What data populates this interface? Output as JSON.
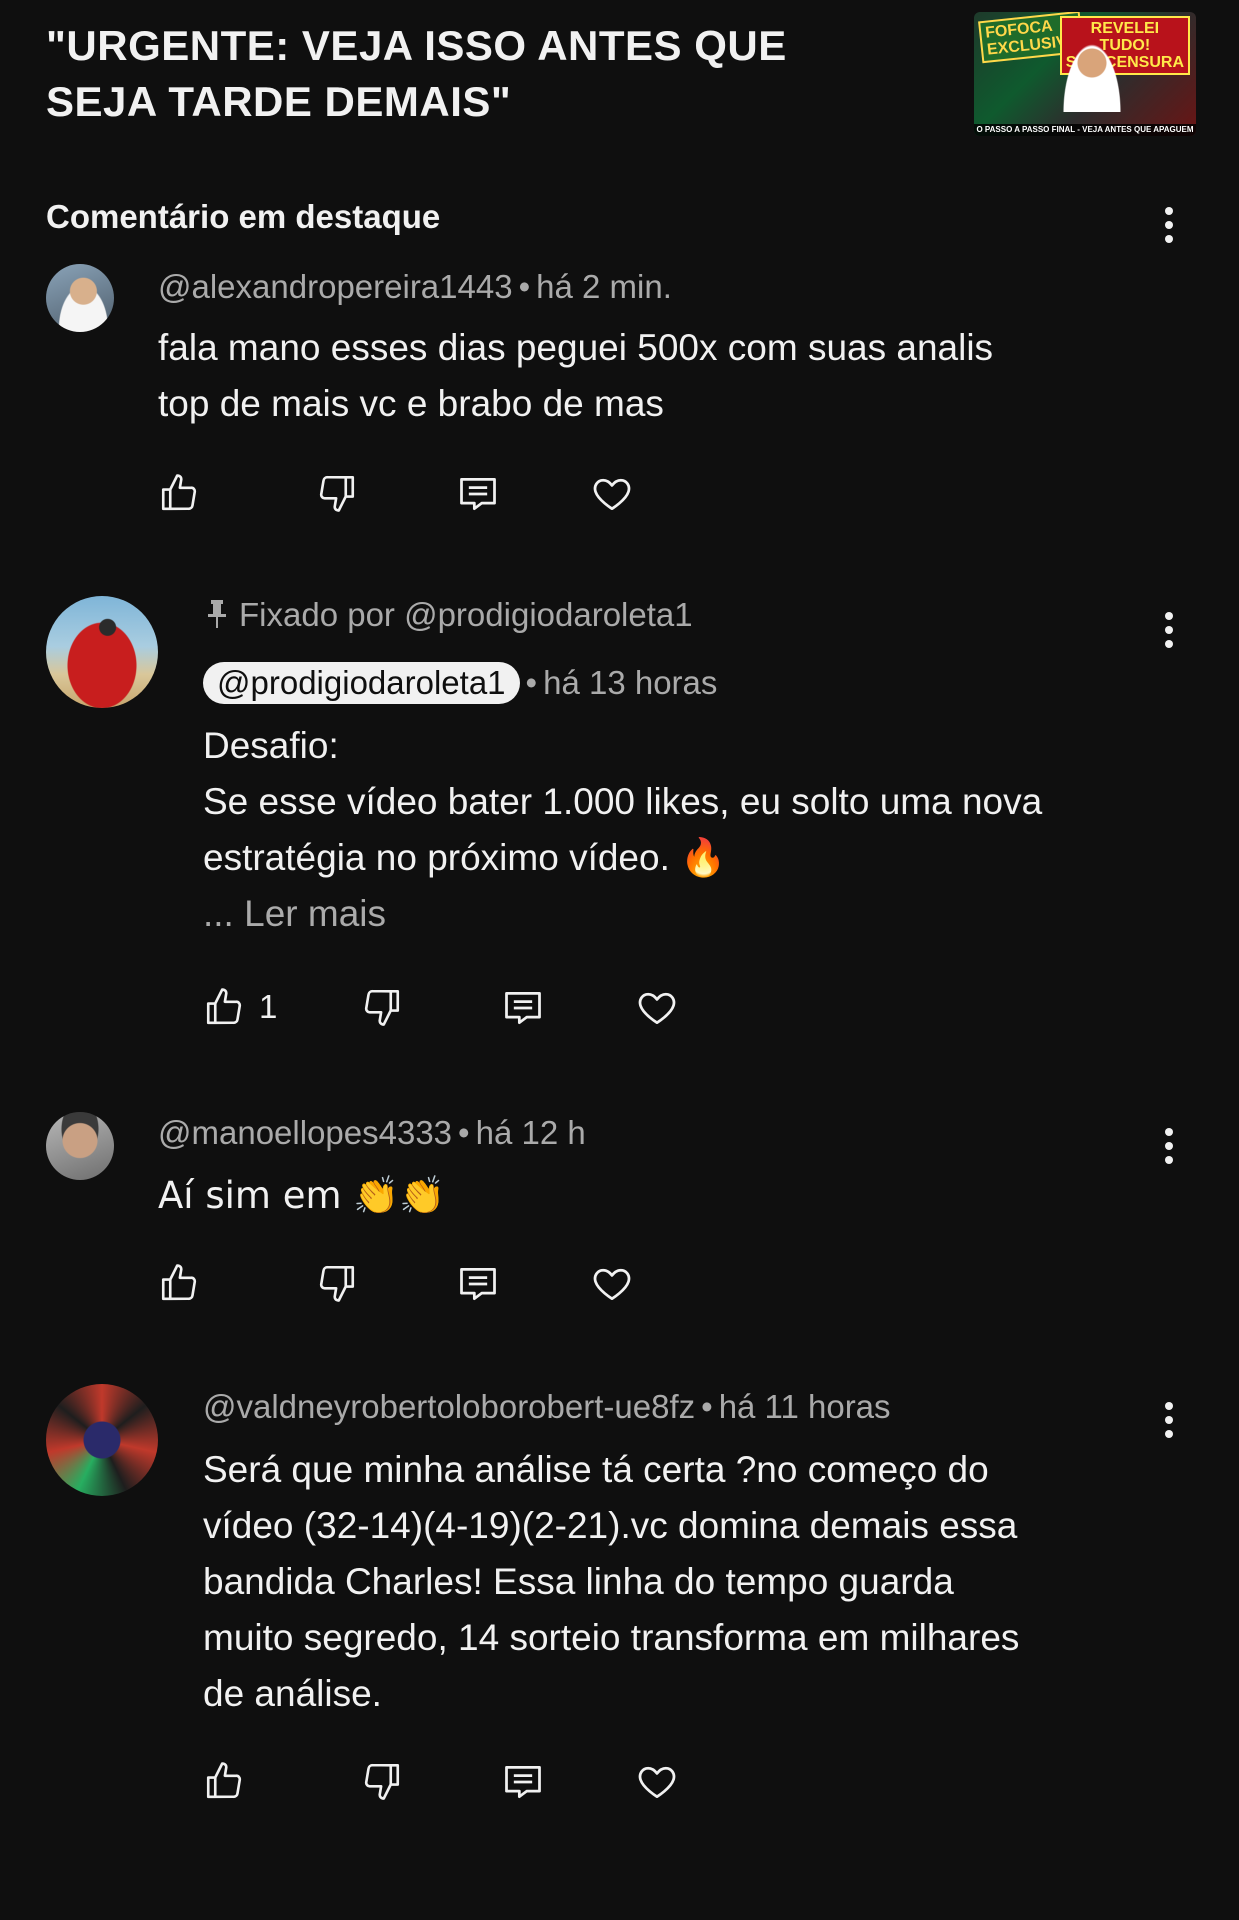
{
  "video": {
    "title": "\"URGENTE: VEJA ISSO ANTES QUE\nSEJA TARDE DEMAIS\"",
    "thumbnail": {
      "left_text": "FOFOCA\nEXCLUSIVA",
      "right_text": "REVELEI\nTUDO!\nSEM CENSURA",
      "bottom_text": "O PASSO A PASSO FINAL - VEJA ANTES QUE APAGUEM"
    }
  },
  "section": {
    "title": "Comentário em destaque"
  },
  "comments": [
    {
      "author": "@alexandropereira1443",
      "time": "há 2 min.",
      "text": "fala mano esses dias peguei 500x com suas analis\ntop de mais vc e brabo de mas",
      "likes": ""
    },
    {
      "pinned_label": "Fixado por @prodigiodaroleta1",
      "author": "@prodigiodaroleta1",
      "time": "há 13 horas",
      "text": "Desafio:\nSe esse vídeo bater 1.000 likes, eu solto uma nova\nestratégia no próximo vídeo. 🔥",
      "read_more": "... Ler mais",
      "likes": "1"
    },
    {
      "author": "@manoellopes4333",
      "time": "há 12 h",
      "text": "Aí sim em 👏👏",
      "likes": ""
    },
    {
      "author": "@valdneyrobertoloborobert-ue8fz",
      "time": "há 11 horas",
      "text": "Será que minha análise tá certa ?no começo do\nvídeo (32-14)(4-19)(2-21).vc domina demais essa\nbandida Charles! Essa linha do tempo guarda\nmuito segredo, 14 sorteio transforma em milhares\nde análise.",
      "likes": ""
    }
  ],
  "icons": {
    "like": "thumbs-up-icon",
    "dislike": "thumbs-down-icon",
    "reply": "reply-comment-icon",
    "heart": "heart-icon",
    "pin": "pin-icon",
    "more": "more-vertical-icon"
  },
  "colors": {
    "background": "#0f0f0f",
    "text": "#f1f1f1",
    "secondary": "#aaaaaa"
  }
}
